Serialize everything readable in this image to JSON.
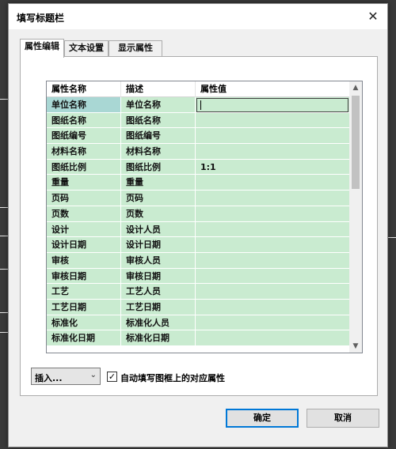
{
  "dialog": {
    "title": "填写标题栏",
    "close_glyph": "✕"
  },
  "tabs": [
    {
      "label": "属性编辑",
      "active": true
    },
    {
      "label": "文本设置",
      "active": false
    },
    {
      "label": "显示属性",
      "active": false
    }
  ],
  "grid": {
    "columns": [
      "属性名称",
      "描述",
      "属性值"
    ],
    "rows": [
      [
        "单位名称",
        "单位名称",
        ""
      ],
      [
        "图纸名称",
        "图纸名称",
        ""
      ],
      [
        "图纸编号",
        "图纸编号",
        ""
      ],
      [
        "材料名称",
        "材料名称",
        ""
      ],
      [
        "图纸比例",
        "图纸比例",
        "1:1"
      ],
      [
        "重量",
        "重量",
        ""
      ],
      [
        "页码",
        "页码",
        ""
      ],
      [
        "页数",
        "页数",
        ""
      ],
      [
        "设计",
        "设计人员",
        ""
      ],
      [
        "设计日期",
        "设计日期",
        ""
      ],
      [
        "审核",
        "审核人员",
        ""
      ],
      [
        "审核日期",
        "审核日期",
        ""
      ],
      [
        "工艺",
        "工艺人员",
        ""
      ],
      [
        "工艺日期",
        "工艺日期",
        ""
      ],
      [
        "标准化",
        "标准化人员",
        ""
      ],
      [
        "标准化日期",
        "标准化日期",
        ""
      ]
    ],
    "selected_row": 0
  },
  "bottom": {
    "insert_label": "插入...",
    "checkbox_checked": true,
    "checkbox_label": "自动填写图框上的对应属性",
    "check_glyph": "✓"
  },
  "buttons": {
    "ok": "确定",
    "cancel": "取消"
  },
  "icons": {
    "scroll_up": "▲",
    "scroll_down": "▼",
    "combo_arrow": "⌄"
  }
}
